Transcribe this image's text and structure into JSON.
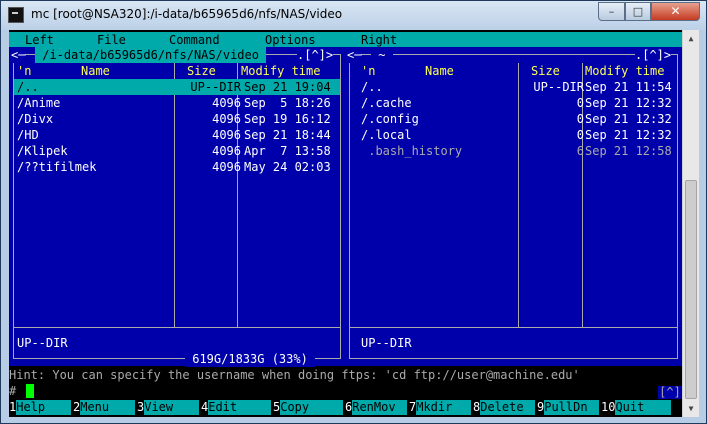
{
  "window": {
    "title": "mc [root@NSA320]:/i-data/b65965d6/nfs/NAS/video",
    "buttons": {
      "minimize": "–",
      "maximize": "□",
      "close": "✕"
    }
  },
  "menubar": [
    "Left",
    "File",
    "Command",
    "Options",
    "Right"
  ],
  "left_panel": {
    "path": " /i-data/b65965d6/nfs/NAS/video ",
    "left_marker": "<─",
    "right_marker": ".[^]>",
    "columns": {
      "sort": "'n",
      "name": "Name",
      "size": "Size",
      "mtime": "Modify time"
    },
    "rows": [
      {
        "name": "/..",
        "size": "UP--DIR",
        "mtime": "Sep 21 19:04",
        "selected": true
      },
      {
        "name": "/Anime",
        "size": "4096",
        "mtime": "Sep  5 18:26"
      },
      {
        "name": "/Divx",
        "size": "4096",
        "mtime": "Sep 19 16:12"
      },
      {
        "name": "/HD",
        "size": "4096",
        "mtime": "Sep 21 18:44"
      },
      {
        "name": "/Klipek",
        "size": "4096",
        "mtime": "Apr  7 13:58"
      },
      {
        "name": "/??tifilmek",
        "size": "4096",
        "mtime": "May 24 02:03"
      }
    ],
    "status": "UP--DIR",
    "disk": " 619G/1833G (33%) "
  },
  "right_panel": {
    "path": " ~ ",
    "left_marker": "<─",
    "right_marker": ".[^]>",
    "columns": {
      "sort": "'n",
      "name": "Name",
      "size": "Size",
      "mtime": "Modify time"
    },
    "rows": [
      {
        "name": "/..",
        "size": "UP--DIR",
        "mtime": "Sep 21 11:54"
      },
      {
        "name": "/.cache",
        "size": "0",
        "mtime": "Sep 21 12:32"
      },
      {
        "name": "/.config",
        "size": "0",
        "mtime": "Sep 21 12:32"
      },
      {
        "name": "/.local",
        "size": "0",
        "mtime": "Sep 21 12:32"
      },
      {
        "name": " .bash_history",
        "size": "6",
        "mtime": "Sep 21 12:58",
        "dim": true
      }
    ],
    "status": "UP--DIR"
  },
  "hint": "Hint: You can specify the username when doing ftps: 'cd ftp://user@machine.edu'",
  "prompt": "#",
  "hotlist_marker": "[^]",
  "function_keys": [
    {
      "num": "1",
      "label": "Help"
    },
    {
      "num": "2",
      "label": "Menu"
    },
    {
      "num": "3",
      "label": "View"
    },
    {
      "num": "4",
      "label": "Edit"
    },
    {
      "num": "5",
      "label": "Copy"
    },
    {
      "num": "6",
      "label": "RenMov"
    },
    {
      "num": "7",
      "label": "Mkdir"
    },
    {
      "num": "8",
      "label": "Delete"
    },
    {
      "num": "9",
      "label": "PullDn"
    },
    {
      "num": "10",
      "label": "Quit"
    }
  ],
  "colors": {
    "panel_bg": "#0000aa",
    "bar": "#00aaaa",
    "header": "#ffff55",
    "cursor": "#00ff00"
  }
}
